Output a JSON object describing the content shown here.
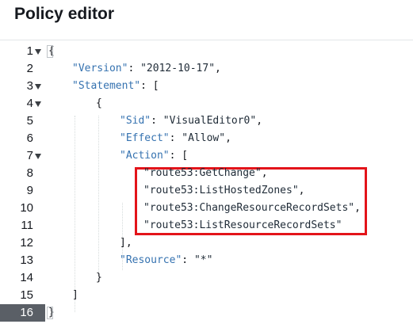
{
  "page": {
    "title": "Policy editor"
  },
  "editor": {
    "active_line": 16,
    "lines": [
      {
        "num": "1",
        "fold": true,
        "tokens": [
          {
            "t": "{",
            "k": "brace"
          }
        ]
      },
      {
        "num": "2",
        "fold": false,
        "tokens": [
          {
            "t": "\"Version\"",
            "k": "key"
          },
          {
            "t": ": ",
            "k": "pun"
          },
          {
            "t": "\"2012-10-17\"",
            "k": "str"
          },
          {
            "t": ",",
            "k": "pun"
          }
        ]
      },
      {
        "num": "3",
        "fold": true,
        "tokens": [
          {
            "t": "\"Statement\"",
            "k": "key"
          },
          {
            "t": ": [",
            "k": "pun"
          }
        ]
      },
      {
        "num": "4",
        "fold": true,
        "tokens": [
          {
            "t": "{",
            "k": "brace"
          }
        ]
      },
      {
        "num": "5",
        "fold": false,
        "tokens": [
          {
            "t": "\"Sid\"",
            "k": "key"
          },
          {
            "t": ": ",
            "k": "pun"
          },
          {
            "t": "\"VisualEditor0\"",
            "k": "str"
          },
          {
            "t": ",",
            "k": "pun"
          }
        ]
      },
      {
        "num": "6",
        "fold": false,
        "tokens": [
          {
            "t": "\"Effect\"",
            "k": "key"
          },
          {
            "t": ": ",
            "k": "pun"
          },
          {
            "t": "\"Allow\"",
            "k": "str"
          },
          {
            "t": ",",
            "k": "pun"
          }
        ]
      },
      {
        "num": "7",
        "fold": true,
        "tokens": [
          {
            "t": "\"Action\"",
            "k": "key"
          },
          {
            "t": ": [",
            "k": "pun"
          }
        ]
      },
      {
        "num": "8",
        "fold": false,
        "tokens": [
          {
            "t": "\"route53:GetChange\"",
            "k": "str"
          },
          {
            "t": ",",
            "k": "pun"
          }
        ]
      },
      {
        "num": "9",
        "fold": false,
        "tokens": [
          {
            "t": "\"route53:ListHostedZones\"",
            "k": "str"
          },
          {
            "t": ",",
            "k": "pun"
          }
        ]
      },
      {
        "num": "10",
        "fold": false,
        "tokens": [
          {
            "t": "\"route53:ChangeResourceRecordSets\"",
            "k": "str"
          },
          {
            "t": ",",
            "k": "pun"
          }
        ]
      },
      {
        "num": "11",
        "fold": false,
        "tokens": [
          {
            "t": "\"route53:ListResourceRecordSets\"",
            "k": "str"
          }
        ]
      },
      {
        "num": "12",
        "fold": false,
        "tokens": [
          {
            "t": "],",
            "k": "pun"
          }
        ]
      },
      {
        "num": "13",
        "fold": false,
        "tokens": [
          {
            "t": "\"Resource\"",
            "k": "key"
          },
          {
            "t": ": ",
            "k": "pun"
          },
          {
            "t": "\"*\"",
            "k": "str"
          }
        ]
      },
      {
        "num": "14",
        "fold": false,
        "tokens": [
          {
            "t": "}",
            "k": "brace"
          }
        ]
      },
      {
        "num": "15",
        "fold": false,
        "tokens": [
          {
            "t": "]",
            "k": "pun"
          }
        ]
      },
      {
        "num": "16",
        "fold": false,
        "tokens": [
          {
            "t": "}",
            "k": "brace"
          }
        ]
      }
    ]
  },
  "colors": {
    "key": "#3572b0",
    "highlight_border": "#e3141a",
    "active_gutter": "#5a5f66"
  },
  "icons": {
    "fold": "fold-arrow-icon"
  }
}
